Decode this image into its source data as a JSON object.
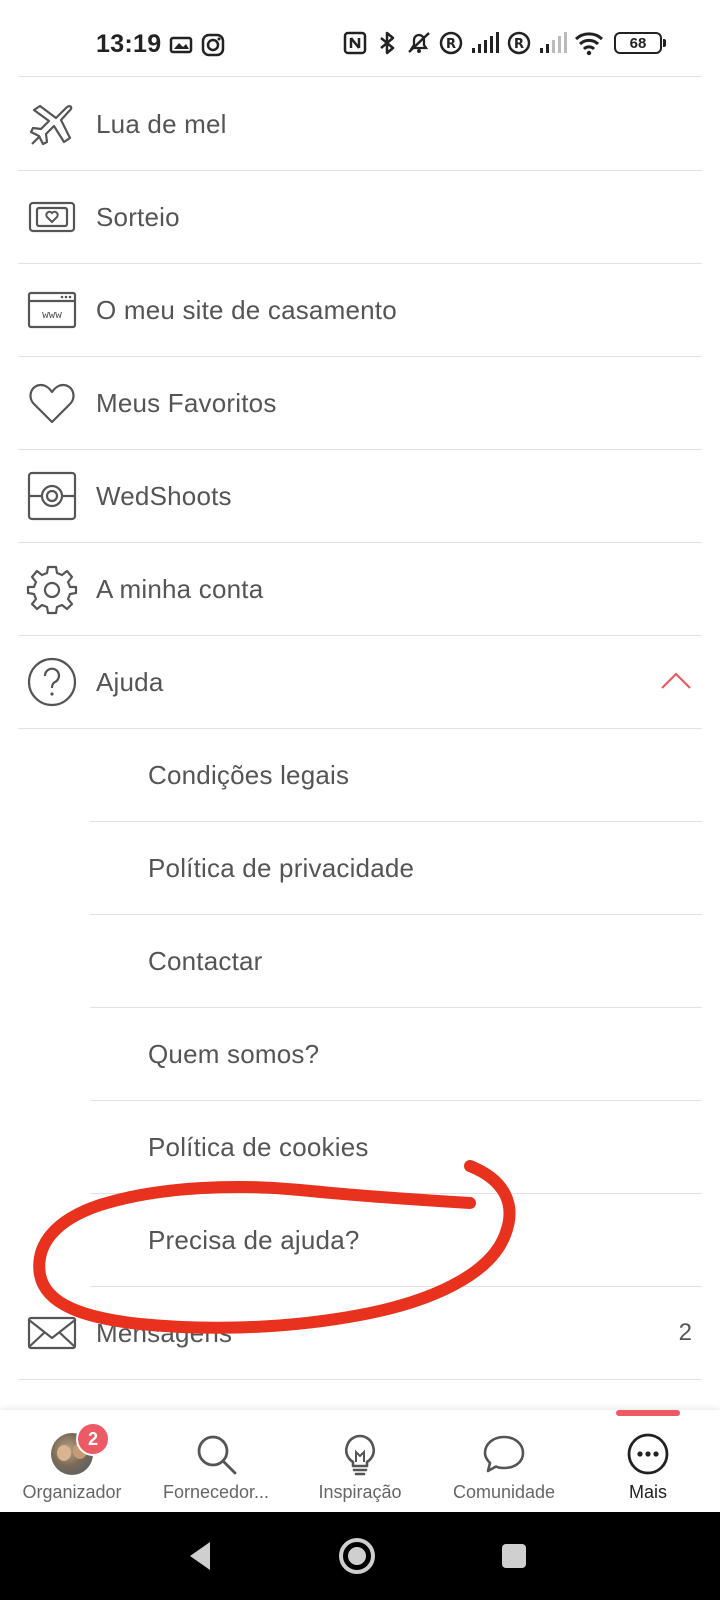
{
  "status_bar": {
    "time": "13:19",
    "battery": "68",
    "icons": [
      "notification-image-icon",
      "instagram-icon",
      "nfc-icon",
      "bluetooth-icon",
      "mute-icon",
      "roaming-icon",
      "signal-icon",
      "roaming-icon",
      "signal-icon",
      "wifi-icon",
      "battery-icon"
    ]
  },
  "menu": {
    "items": [
      {
        "label": "Lua de mel",
        "icon": "airplane-icon"
      },
      {
        "label": "Sorteio",
        "icon": "ticket-icon"
      },
      {
        "label": "O meu site de casamento",
        "icon": "website-icon",
        "icon_text": "www"
      },
      {
        "label": "Meus Favoritos",
        "icon": "heart-icon"
      },
      {
        "label": "WedShoots",
        "icon": "camera-icon"
      },
      {
        "label": "A minha conta",
        "icon": "gear-icon"
      },
      {
        "label": "Ajuda",
        "icon": "help-icon",
        "expanded": true,
        "chevron": "chevron-up-icon"
      }
    ],
    "help_subitems": [
      {
        "label": "Condições legais"
      },
      {
        "label": "Política de privacidade"
      },
      {
        "label": "Contactar"
      },
      {
        "label": "Quem somos?"
      },
      {
        "label": "Política de cookies"
      },
      {
        "label": "Precisa de ajuda?"
      }
    ],
    "messages": {
      "label": "Mensagens",
      "icon": "mail-icon",
      "count": "2"
    }
  },
  "annotation": {
    "color": "#e8321e",
    "shape": "hand-drawn-circle",
    "target": "Precisa de ajuda?"
  },
  "tab_bar": {
    "accent": "#ec5a66",
    "tabs": [
      {
        "label": "Organizador",
        "icon": "avatar",
        "badge": "2"
      },
      {
        "label": "Fornecedor...",
        "icon": "search-icon"
      },
      {
        "label": "Inspiração",
        "icon": "lightbulb-icon"
      },
      {
        "label": "Comunidade",
        "icon": "chat-bubble-icon"
      },
      {
        "label": "Mais",
        "icon": "more-icon",
        "active": true
      }
    ]
  },
  "nav_bar": {
    "buttons": [
      "back-icon",
      "home-icon",
      "recents-icon"
    ]
  }
}
